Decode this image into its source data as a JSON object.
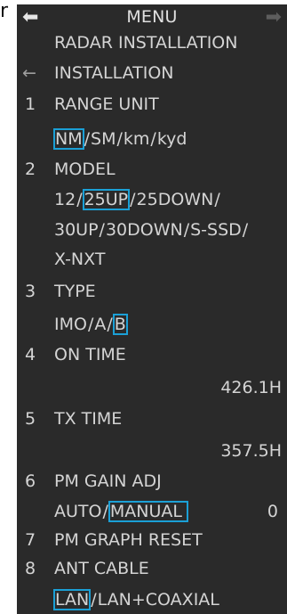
{
  "corner_glyph": "r",
  "header": {
    "title": "MENU",
    "back_icon": "arrow-left-icon",
    "forward_icon": "arrow-right-icon"
  },
  "breadcrumb": {
    "level1": "RADAR INSTALLATION",
    "level2": "INSTALLATION",
    "back_arrow": "←"
  },
  "items": [
    {
      "number": "1",
      "label": "RANGE UNIT",
      "options": [
        "NM",
        "SM",
        "km",
        "kyd"
      ],
      "selected": "NM"
    },
    {
      "number": "2",
      "label": "MODEL",
      "options": [
        "12",
        "25UP",
        "25DOWN",
        "30UP",
        "30DOWN",
        "S-SSD",
        "X-NXT"
      ],
      "selected": "25UP"
    },
    {
      "number": "3",
      "label": "TYPE",
      "options": [
        "IMO",
        "A",
        "B"
      ],
      "selected": "B"
    },
    {
      "number": "4",
      "label": "ON TIME",
      "value": "426.1H"
    },
    {
      "number": "5",
      "label": "TX TIME",
      "value": "357.5H"
    },
    {
      "number": "6",
      "label": "PM GAIN ADJ",
      "options": [
        "AUTO",
        "MANUAL"
      ],
      "selected": "MANUAL",
      "value": "0"
    },
    {
      "number": "7",
      "label": "PM GRAPH RESET"
    },
    {
      "number": "8",
      "label": "ANT CABLE",
      "options": [
        "LAN",
        "LAN+COAXIAL"
      ],
      "selected": "LAN"
    }
  ],
  "colors": {
    "panel_bg": "#2a2a2a",
    "text": "#d4d4d4",
    "selection_outline": "#1ba0d6",
    "disabled_arrow": "#5d5d5d"
  }
}
